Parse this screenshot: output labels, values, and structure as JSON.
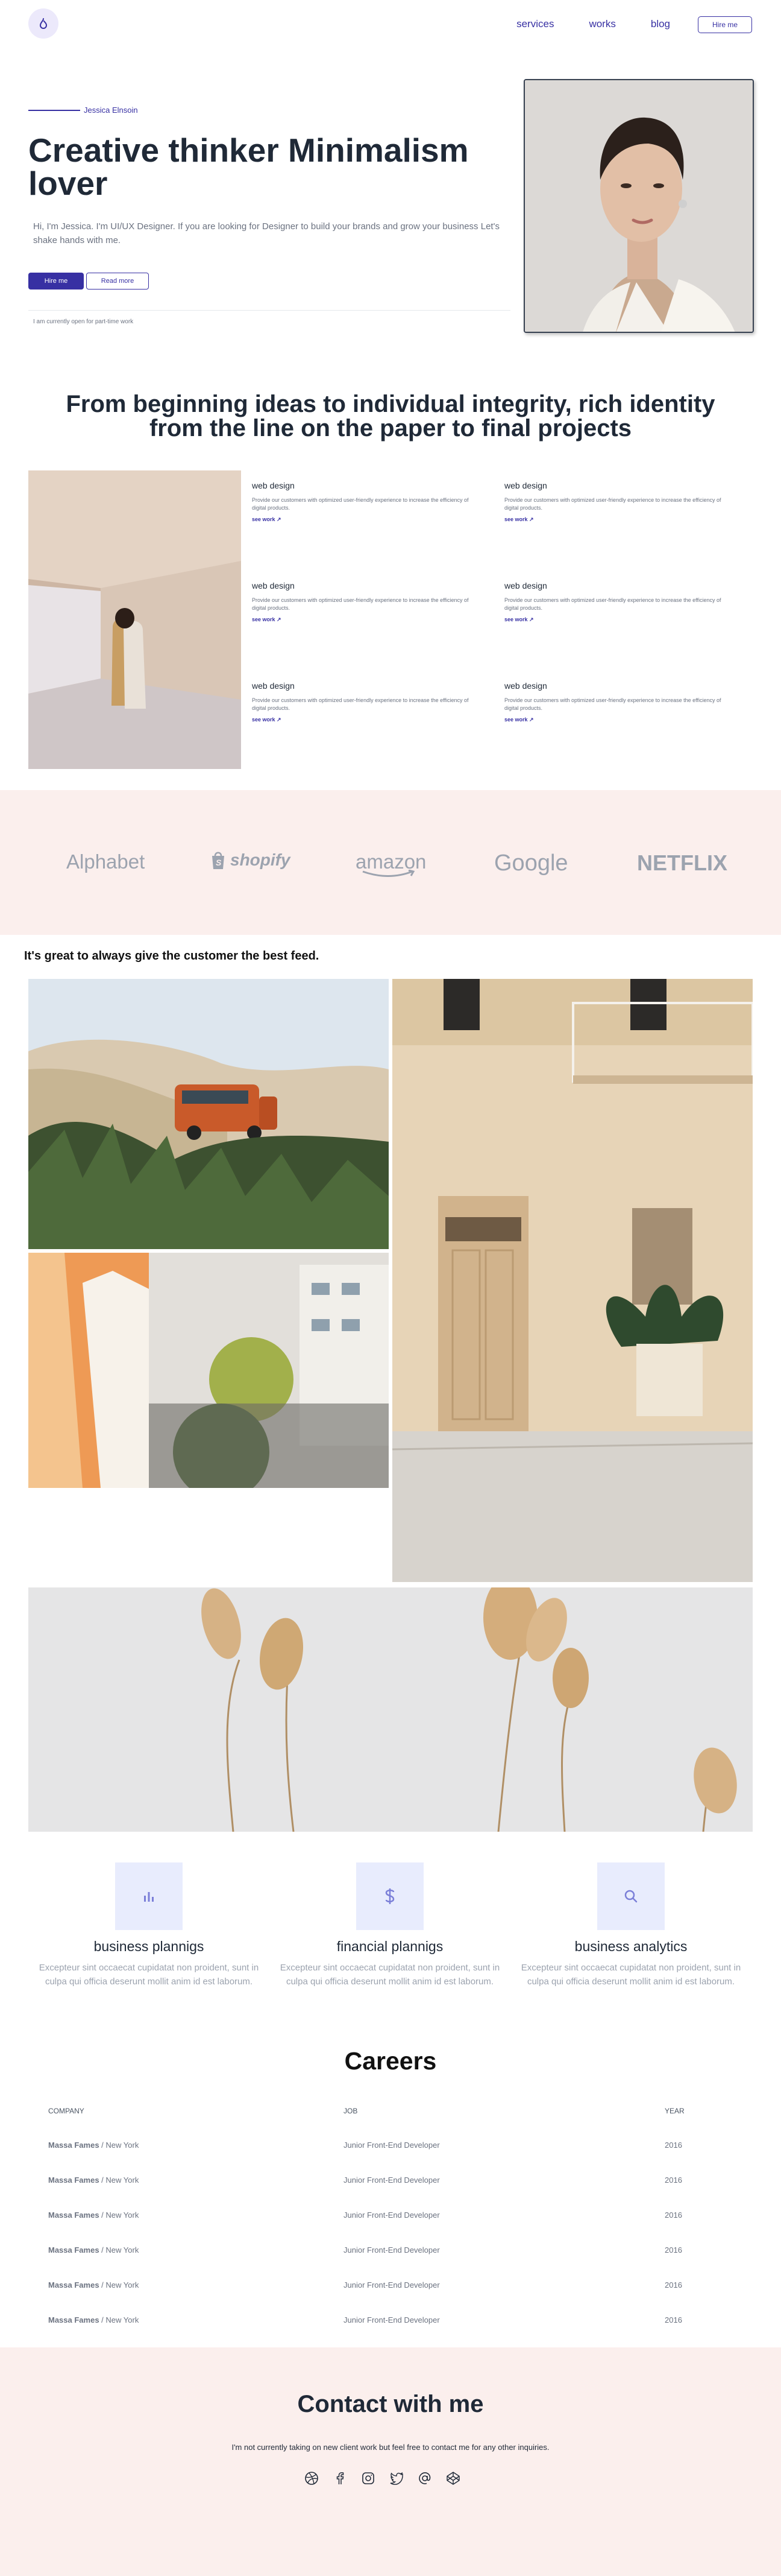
{
  "nav": {
    "links": [
      "services",
      "works",
      "blog"
    ],
    "hire_label": "Hire me"
  },
  "hero": {
    "tag": "Jessica Elnsoin",
    "title": "Creative thinker Minimalism lover",
    "description": "Hi, I'm Jessica. I'm UI/UX Designer. If you are looking for Designer to build your brands and grow your business Let's shake hands with me.",
    "primary_button": "Hire me",
    "secondary_button": "Read more",
    "note": "I am currently open for part-time work"
  },
  "ideas": {
    "title_line1": "From beginning ideas to individual integrity, rich identity",
    "title_line2": "from the line on the paper to final projects",
    "services": [
      {
        "title": "web design",
        "desc": "Provide our customers with optimized user-friendly experience to increase the efficiency of digital products.",
        "link": "see work ↗"
      },
      {
        "title": "web design",
        "desc": "Provide our customers with optimized user-friendly experience to increase the efficiency of digital products.",
        "link": "see work ↗"
      },
      {
        "title": "web design",
        "desc": "Provide our customers with optimized user-friendly experience to increase the efficiency of digital products.",
        "link": "see work ↗"
      },
      {
        "title": "web design",
        "desc": "Provide our customers with optimized user-friendly experience to increase the efficiency of digital products.",
        "link": "see work ↗"
      },
      {
        "title": "web design",
        "desc": "Provide our customers with optimized user-friendly experience to increase the efficiency of digital products.",
        "link": "see work ↗"
      },
      {
        "title": "web design",
        "desc": "Provide our customers with optimized user-friendly experience to increase the efficiency of digital products.",
        "link": "see work ↗"
      }
    ]
  },
  "brands": [
    "Alphabet",
    "shopify",
    "amazon",
    "Google",
    "NETFLIX"
  ],
  "gallery": {
    "title": "It's great to always give the customer the best feed."
  },
  "features": [
    {
      "title": "business plannigs",
      "icon": "bar-chart-icon",
      "desc": "Excepteur sint occaecat cupidatat non proident, sunt in culpa qui officia deserunt mollit anim id est laborum."
    },
    {
      "title": "financial plannigs",
      "icon": "dollar-icon",
      "desc": "Excepteur sint occaecat cupidatat non proident, sunt in culpa qui officia deserunt mollit anim id est laborum."
    },
    {
      "title": "business analytics",
      "icon": "search-icon",
      "desc": "Excepteur sint occaecat cupidatat non proident, sunt in culpa qui officia deserunt mollit anim id est laborum."
    }
  ],
  "careers": {
    "title": "Careers",
    "headers": [
      "COMPANY",
      "JOB",
      "YEAR"
    ],
    "rows": [
      {
        "company": "Massa Fames",
        "location": "New York",
        "job": "Junior Front-End Developer",
        "year": "2016"
      },
      {
        "company": "Massa Fames",
        "location": "New York",
        "job": "Junior Front-End Developer",
        "year": "2016"
      },
      {
        "company": "Massa Fames",
        "location": "New York",
        "job": "Junior Front-End Developer",
        "year": "2016"
      },
      {
        "company": "Massa Fames",
        "location": "New York",
        "job": "Junior Front-End Developer",
        "year": "2016"
      },
      {
        "company": "Massa Fames",
        "location": "New York",
        "job": "Junior Front-End Developer",
        "year": "2016"
      },
      {
        "company": "Massa Fames",
        "location": "New York",
        "job": "Junior Front-End Developer",
        "year": "2016"
      }
    ]
  },
  "contact": {
    "title": "Contact with me",
    "text": "I'm not currently taking on new client work but feel free to contact me for any other inquiries.",
    "socials": [
      "dribbble-icon",
      "facebook-icon",
      "instagram-icon",
      "twitter-icon",
      "at-icon",
      "codepen-icon"
    ]
  },
  "colors": {
    "accent": "#3730a3",
    "pink_bg": "#fbefed",
    "icon_bg": "#e8ecfd"
  }
}
